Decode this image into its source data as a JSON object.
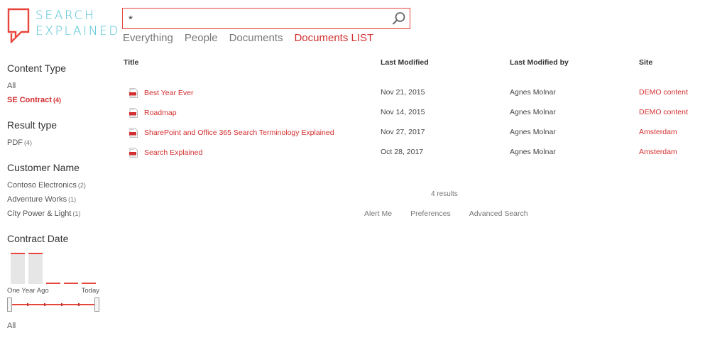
{
  "logo": {
    "line1": "SEARCH",
    "line2": "EXPLAINED"
  },
  "search": {
    "value": "*"
  },
  "verticals": [
    {
      "label": "Everything",
      "active": false
    },
    {
      "label": "People",
      "active": false
    },
    {
      "label": "Documents",
      "active": false
    },
    {
      "label": "Documents LIST",
      "active": true
    }
  ],
  "refiners": {
    "content_type": {
      "title": "Content Type",
      "items": [
        {
          "label": "All",
          "count": ""
        },
        {
          "label": "SE Contract",
          "count": "(4)"
        }
      ]
    },
    "result_type": {
      "title": "Result type",
      "items": [
        {
          "label": "PDF",
          "count": "(4)"
        }
      ]
    },
    "customer_name": {
      "title": "Customer Name",
      "items": [
        {
          "label": "Contoso Electronics",
          "count": "(2)"
        },
        {
          "label": "Adventure Works",
          "count": "(1)"
        },
        {
          "label": "City Power & Light",
          "count": "(1)"
        }
      ]
    },
    "contract_date": {
      "title": "Contract Date",
      "histogram": [
        1,
        1,
        0,
        0,
        0
      ],
      "start_label": "One Year Ago",
      "end_label": "Today",
      "all_label": "All"
    }
  },
  "table": {
    "headers": {
      "title": "Title",
      "modified": "Last Modified",
      "modified_by": "Last Modified by",
      "site": "Site"
    },
    "rows": [
      {
        "title": "Best Year Ever",
        "modified": "Nov 21, 2015",
        "modified_by": "Agnes Molnar",
        "site": "DEMO content",
        "icon": "pdf-icon"
      },
      {
        "title": "Roadmap",
        "modified": "Nov 14, 2015",
        "modified_by": "Agnes Molnar",
        "site": "DEMO content",
        "icon": "pdf-icon"
      },
      {
        "title": "SharePoint and Office 365 Search Terminology Explained",
        "modified": "Nov 27, 2017",
        "modified_by": "Agnes Molnar",
        "site": "Amsterdam",
        "icon": "pdf-icon"
      },
      {
        "title": "Search Explained",
        "modified": "Oct 28, 2017",
        "modified_by": "Agnes Molnar",
        "site": "Amsterdam",
        "icon": "pdf-icon"
      }
    ]
  },
  "result_count": "4 results",
  "footer": {
    "alert_me": "Alert Me",
    "preferences": "Preferences",
    "advanced_search": "Advanced Search"
  },
  "colors": {
    "accent": "#d32f2f",
    "logo": "#4fc1d6",
    "logo_mark": "#e8453c"
  }
}
